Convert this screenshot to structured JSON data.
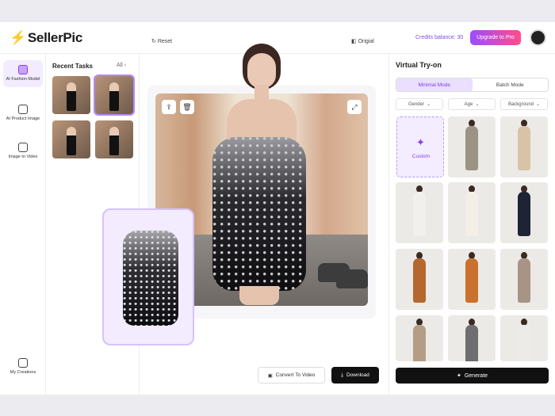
{
  "brand": {
    "name": "SellerPic"
  },
  "header": {
    "credits": "Credits balance: 30",
    "upgrade_label": "Upgrade to Pro"
  },
  "nav": {
    "items": [
      {
        "label": "AI Fashion Model"
      },
      {
        "label": "AI Product Image"
      },
      {
        "label": "Image to Video"
      },
      {
        "label": "My Creations"
      }
    ]
  },
  "recent": {
    "title": "Recent Tasks",
    "all_label": "All"
  },
  "editor": {
    "reset_label": "Reset",
    "original_label": "Origial",
    "convert_label": "Convert To Video",
    "download_label": "Download"
  },
  "panel": {
    "title": "Virtual Try-on",
    "modes": [
      "Minimal Mode",
      "Batch Mode"
    ],
    "filters": [
      "Gender",
      "Age",
      "Background"
    ],
    "custom_label": "Custom",
    "generate_label": "Generate"
  },
  "colors": {
    "accent": "#8b3cf7",
    "upgrade_from": "#9b4dff",
    "upgrade_to": "#ff4d8a"
  },
  "icons": [
    "bolt-icon",
    "reset-icon",
    "compare-icon",
    "share-icon",
    "trash-icon",
    "expand-icon",
    "video-icon",
    "download-icon",
    "magic-icon",
    "chevron-down-icon"
  ]
}
